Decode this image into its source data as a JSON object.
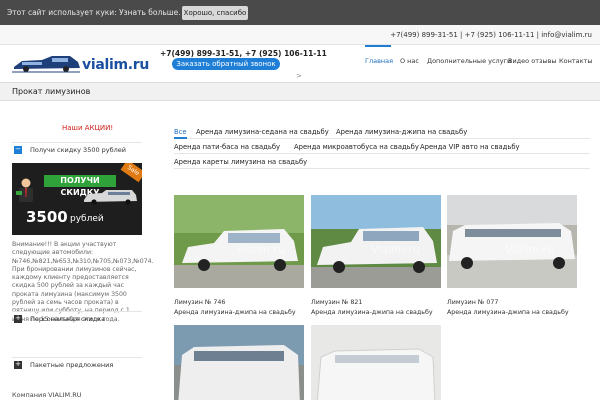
{
  "cookie": {
    "text": "Этот сайт использует куки: Узнать больше.",
    "ok_button": "Хорошо, спасибо"
  },
  "topbar": {
    "contacts": "+7(499) 899-31-51 | +7 (925) 106-11-11  |  info@vialim.ru"
  },
  "header": {
    "logo_text": "vialim.ru",
    "phones": "+7(499) 899-31-51, +7 (925) 106-11-11",
    "callback_button": "Заказать обратный звонок",
    "nav": [
      {
        "label": "Главная"
      },
      {
        "label": "О нас"
      },
      {
        "label": "Дополнительные услуги"
      },
      {
        "label": "Видео отзывы"
      },
      {
        "label": "Контакты"
      }
    ],
    "arrow": ">"
  },
  "page_title": "Прокат лимузинов",
  "sidebar": {
    "promo_title": "Наши АКЦИИ!",
    "discount_item": "Получи скидку 3500 рублей",
    "discount_toggle": "−",
    "banner": {
      "headline": "ПОЛУЧИ СКИДКУ",
      "amount": "3500",
      "currency": "рублей",
      "tag": "Sale"
    },
    "text": "Внимание!!! В акции участвуют следующие автомобили: №746,№821,№653,№310,№705,№073,№074. При бронировании лимузинов сейчас, каждому клиенту предоставляется скидка 500 рублей за каждый час проката лимузина (максимум 3500 рублей за семь часов проката) в пятницу или субботу, на период с 1 июня по 15 сентября этого года.",
    "items": [
      {
        "label": "Персональная скидка",
        "toggle": "+"
      },
      {
        "label": "Пакетные предложения",
        "toggle": "+"
      }
    ],
    "company_label": "Компания VIALIM.RU"
  },
  "filters": {
    "rows": [
      [
        "Все",
        "Аренда лимузина-седана на свадьбу",
        "Аренда лимузина-джипа на свадьбу"
      ],
      [
        "Аренда пати-баса на свадьбу",
        "Аренда микроавтобуса на свадьбу",
        "Аренда VIP авто на свадьбу"
      ],
      [
        "Аренда кареты лимузина на свадьбу"
      ]
    ]
  },
  "cards": [
    {
      "name": "Лимузин № 746",
      "category": "Аренда лимузина-джипа на свадьбу"
    },
    {
      "name": "Лимузин № 821",
      "category": "Аренда лимузина-джипа на свадьбу"
    },
    {
      "name": "Лимузин № 077",
      "category": "Аренда лимузина-джипа на свадьбу"
    },
    {
      "name": "",
      "category": ""
    },
    {
      "name": "",
      "category": ""
    }
  ],
  "watermark": "Vialim.ru",
  "colors": {
    "accent": "#1f7fd6",
    "promo_red": "#d0201a",
    "cookie_bg": "#4a4a4a"
  }
}
